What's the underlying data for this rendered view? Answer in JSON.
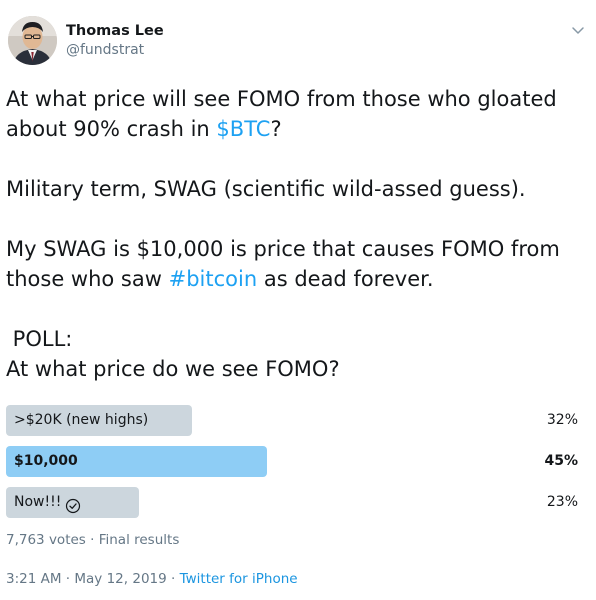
{
  "user": {
    "display_name": "Thomas Lee",
    "handle": "@fundstrat"
  },
  "tweet": {
    "line1_pre": "At what price will see FOMO from those who gloated about 90% crash in ",
    "line1_link": "$BTC",
    "line1_post": "?",
    "line2": "Military term, SWAG (scientific wild-assed guess).",
    "line3_pre": "My SWAG is $10,000 is price that causes FOMO from those who saw ",
    "line3_link": "#bitcoin",
    "line3_post": " as dead forever.",
    "line4": " POLL:",
    "line5": "At what price do we see FOMO?"
  },
  "poll": {
    "options": [
      {
        "label": ">$20K (new highs)",
        "percent_text": "32%",
        "percent": 32,
        "winner": false
      },
      {
        "label": "$10,000",
        "percent_text": "45%",
        "percent": 45,
        "winner": true
      },
      {
        "label": "Now!!!",
        "percent_text": "23%",
        "percent": 23,
        "winner": false,
        "selected": true
      }
    ],
    "votes": "7,763 votes",
    "separator": "·",
    "status": "Final results"
  },
  "meta": {
    "time": "3:21 AM",
    "separator": "·",
    "date": "May 12, 2019",
    "source": "Twitter for iPhone"
  },
  "icons": {
    "menu": "chevron-down-icon",
    "vote": "check-circle-icon"
  },
  "colors": {
    "link": "#1da1f2",
    "poll_bar": "#ccd6dd",
    "poll_bar_winner": "#8ecdf5",
    "secondary_text": "#657786"
  }
}
